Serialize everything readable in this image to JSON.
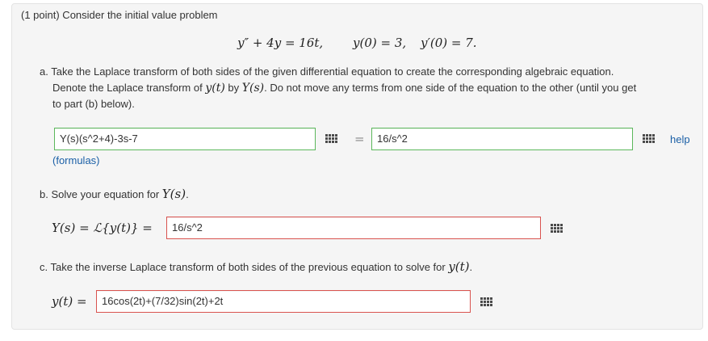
{
  "header": "(1 point) Consider the initial value problem",
  "equation": {
    "ode": "y″ + 4y = 16t,",
    "ic1": "y(0) = 3,",
    "ic2": "y′(0) = 7."
  },
  "part_a": {
    "line1": "a. Take the Laplace transform of both sides of the given differential equation to create the corresponding algebraic equation.",
    "line2_pre": "Denote the Laplace transform of ",
    "line2_yt": "y(t)",
    "line2_by": " by ",
    "line2_Ys": "Y(s)",
    "line2_post": ". Do not move any terms from one side of the equation to the other (until you get",
    "line3": "to part (b) below).",
    "left_input": "Y(s)(s^2+4)-3s-7",
    "equals": "=",
    "right_input": "16/s^2",
    "formulas_link": "(formulas)",
    "help_link": "help"
  },
  "part_b": {
    "prompt_pre": "b. Solve your equation for ",
    "prompt_Ys": "Y(s)",
    "prompt_post": ".",
    "label": "Y(s) = ℒ{y(t)} =",
    "input": "16/s^2"
  },
  "part_c": {
    "prompt_pre": "c. Take the inverse Laplace transform of both sides of the previous equation to solve for ",
    "prompt_yt": "y(t)",
    "prompt_post": ".",
    "label": "y(t) =",
    "input": "16cos(2t)+(7/32)sin(2t)+2t"
  },
  "colors": {
    "correct_border": "#5cb85c",
    "incorrect_border": "#d9534f",
    "link": "#1a5fa6",
    "panel_bg": "#f5f5f5"
  },
  "icons": [
    "equation-editor-icon",
    "equation-editor-icon",
    "equation-editor-icon",
    "equation-editor-icon"
  ]
}
